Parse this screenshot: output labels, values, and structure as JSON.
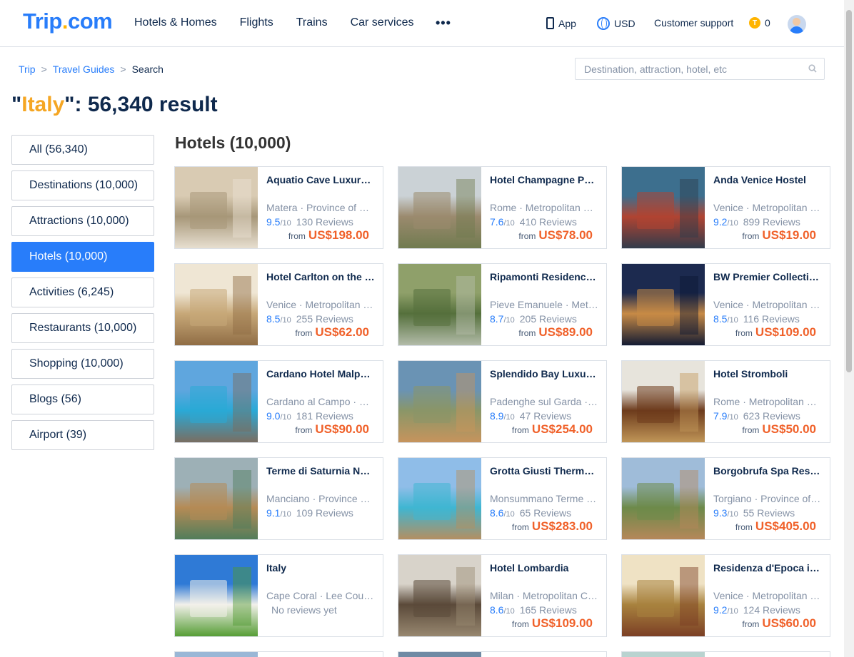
{
  "header": {
    "logo_main": "Trip",
    "logo_dot": ".",
    "logo_end": "com",
    "nav": [
      "Hotels & Homes",
      "Flights",
      "Trains",
      "Car services"
    ],
    "more": "•••",
    "app_label": "App",
    "currency": "USD",
    "support": "Customer support",
    "coins_icon": "T",
    "coins": "0"
  },
  "breadcrumb": [
    "Trip",
    "Travel Guides",
    "Search"
  ],
  "breadcrumb_sep": ">",
  "search": {
    "placeholder": "Destination, attraction, hotel, etc",
    "value": ""
  },
  "title": {
    "q1": "\"",
    "keyword": "Italy",
    "rest": "\": 56,340 result"
  },
  "sidebar": [
    {
      "label": "All (56,340)",
      "active": false
    },
    {
      "label": "Destinations (10,000)",
      "active": false
    },
    {
      "label": "Attractions (10,000)",
      "active": false
    },
    {
      "label": "Hotels (10,000)",
      "active": true
    },
    {
      "label": "Activities (6,245)",
      "active": false
    },
    {
      "label": "Restaurants (10,000)",
      "active": false
    },
    {
      "label": "Shopping (10,000)",
      "active": false
    },
    {
      "label": "Blogs (56)",
      "active": false
    },
    {
      "label": "Airport (39)",
      "active": false
    }
  ],
  "section_title": "Hotels (10,000)",
  "hotels": [
    {
      "name": "Aquatio Cave Luxury Hotel & SPA",
      "location": "Matera · Province of Matera",
      "score": "9.5",
      "denom": "/10",
      "reviews": "130 Reviews",
      "from": "from",
      "price": "US$198.00",
      "img": [
        "#d9cbb3",
        "#a79779",
        "#eae2d4"
      ]
    },
    {
      "name": "Hotel Champagne Palace",
      "location": "Rome · Metropolitan City of Rome",
      "score": "7.6",
      "denom": "/10",
      "reviews": "410 Reviews",
      "from": "from",
      "price": "US$78.00",
      "img": [
        "#cbd2d6",
        "#9b8a6e",
        "#6e7a4e"
      ]
    },
    {
      "name": "Anda Venice Hostel",
      "location": "Venice · Metropolitan City of Venice",
      "score": "9.2",
      "denom": "/10",
      "reviews": "899 Reviews",
      "from": "from",
      "price": "US$19.00",
      "img": [
        "#3d6f8e",
        "#b04432",
        "#2c3b4c"
      ]
    },
    {
      "name": "Hotel Carlton on the Grand Canal",
      "location": "Venice · Metropolitan City of Venice",
      "score": "8.5",
      "denom": "/10",
      "reviews": "255 Reviews",
      "from": "from",
      "price": "US$62.00",
      "img": [
        "#efe6d4",
        "#c7a878",
        "#8d6a42"
      ]
    },
    {
      "name": "Ripamonti Residence & Hotel",
      "location": "Pieve Emanuele · Metropolitan City of Milan",
      "score": "8.7",
      "denom": "/10",
      "reviews": "205 Reviews",
      "from": "from",
      "price": "US$89.00",
      "img": [
        "#8fa06a",
        "#55703c",
        "#b7bfae"
      ]
    },
    {
      "name": "BW Premier Collection CHC Continental",
      "location": "Venice · Metropolitan City of Venice",
      "score": "8.5",
      "denom": "/10",
      "reviews": "116 Reviews",
      "from": "from",
      "price": "US$109.00",
      "img": [
        "#1c2a4f",
        "#c78a46",
        "#0c1632"
      ]
    },
    {
      "name": "Cardano Hotel Malpensa",
      "location": "Cardano al Campo · Province of Varese",
      "score": "9.0",
      "denom": "/10",
      "reviews": "181 Reviews",
      "from": "from",
      "price": "US$90.00",
      "img": [
        "#5fa6de",
        "#2aa9d6",
        "#7d6b5c"
      ]
    },
    {
      "name": "Splendido Bay Luxury Spa Resort",
      "location": "Padenghe sul Garda · Province of Brescia",
      "score": "8.9",
      "denom": "/10",
      "reviews": "47 Reviews",
      "from": "from",
      "price": "US$254.00",
      "img": [
        "#6a93b4",
        "#8a9668",
        "#c9945c"
      ]
    },
    {
      "name": "Hotel Stromboli",
      "location": "Rome · Metropolitan City of Rome",
      "score": "7.9",
      "denom": "/10",
      "reviews": "623 Reviews",
      "from": "from",
      "price": "US$50.00",
      "img": [
        "#e7e4dc",
        "#6d3b1c",
        "#c49a5a"
      ]
    },
    {
      "name": "Terme di Saturnia Natural Spa",
      "location": "Manciano · Province of Grosseto",
      "score": "9.1",
      "denom": "/10",
      "reviews": "109 Reviews",
      "from": "",
      "price": "",
      "img": [
        "#9db0b6",
        "#b58b55",
        "#4d7c5b"
      ]
    },
    {
      "name": "Grotta Giusti Thermal Spa Resort",
      "location": "Monsummano Terme · Province of Pistoia",
      "score": "8.6",
      "denom": "/10",
      "reviews": "65 Reviews",
      "from": "from",
      "price": "US$283.00",
      "img": [
        "#8fbde8",
        "#3fb6d2",
        "#b98d5c"
      ]
    },
    {
      "name": "Borgobrufa Spa Resort",
      "location": "Torgiano · Province of Perugia",
      "score": "9.3",
      "denom": "/10",
      "reviews": "55 Reviews",
      "from": "from",
      "price": "US$405.00",
      "img": [
        "#9fbcd9",
        "#6d8a4a",
        "#b8875a"
      ]
    },
    {
      "name": "Italy",
      "location": "Cape Coral · Lee County",
      "score": "",
      "denom": "",
      "reviews": "No reviews yet",
      "from": "",
      "price": "",
      "img": [
        "#2f7ad6",
        "#f2f0ea",
        "#4f9a2e"
      ]
    },
    {
      "name": "Hotel Lombardia",
      "location": "Milan · Metropolitan City of Milan",
      "score": "8.6",
      "denom": "/10",
      "reviews": "165 Reviews",
      "from": "from",
      "price": "US$109.00",
      "img": [
        "#d8d3ca",
        "#5b4a3a",
        "#9a8a72"
      ]
    },
    {
      "name": "Residenza d'Epoca in Piazza della Signoria",
      "location": "Venice · Metropolitan City of Venice",
      "score": "9.2",
      "denom": "/10",
      "reviews": "124 Reviews",
      "from": "from",
      "price": "US$60.00",
      "img": [
        "#efe2c4",
        "#a8823e",
        "#7a3c24"
      ]
    }
  ],
  "partial_colors": [
    "#9ab7d6",
    "#6f8aa4",
    "#b9d3d0"
  ],
  "colors": {
    "brand": "#287dfa",
    "accent": "#f5a623",
    "price": "#f0612a",
    "text": "#0f294d"
  }
}
